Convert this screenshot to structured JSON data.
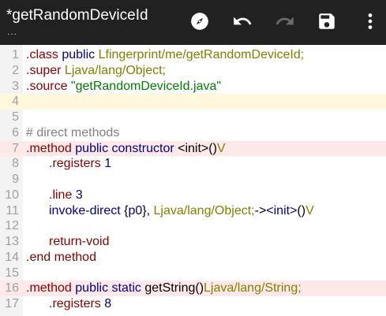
{
  "toolbar": {
    "title": "*getRandomDeviceId",
    "subtitle": "...",
    "icons": [
      "compass-icon",
      "undo-icon",
      "redo-icon",
      "save-icon",
      "more-vert-icon"
    ],
    "redo_enabled": false
  },
  "colors": {
    "toolbar_bg": "#212121",
    "gutter_bg": "#f3f3f3",
    "current_line": "#fff8dc",
    "method_line": "#fde9e9",
    "directive": "#8b0000",
    "modifier": "#00008b",
    "type": "#808000",
    "string": "#008000",
    "comment": "#808080"
  },
  "editor": {
    "lines": [
      {
        "n": "1",
        "tokens": [
          {
            "t": ".class",
            "c": "kw-dir"
          },
          {
            "t": " "
          },
          {
            "t": "public",
            "c": "kw-mod"
          },
          {
            "t": " "
          },
          {
            "t": "Lfingerprint/me/getRandomDeviceId;",
            "c": "type"
          }
        ]
      },
      {
        "n": "2",
        "tokens": [
          {
            "t": ".super",
            "c": "kw-dir"
          },
          {
            "t": " "
          },
          {
            "t": "Ljava/lang/Object;",
            "c": "type"
          }
        ]
      },
      {
        "n": "3",
        "tokens": [
          {
            "t": ".source",
            "c": "kw-dir"
          },
          {
            "t": " "
          },
          {
            "t": "\"getRandomDeviceId.java\"",
            "c": "str"
          }
        ]
      },
      {
        "n": "4",
        "hl": "current",
        "tokens": []
      },
      {
        "n": "5",
        "tokens": []
      },
      {
        "n": "6",
        "tokens": [
          {
            "t": "# direct methods",
            "c": "comment"
          }
        ]
      },
      {
        "n": "7",
        "hl": "method",
        "tokens": [
          {
            "t": ".method",
            "c": "kw-dir"
          },
          {
            "t": " "
          },
          {
            "t": "public",
            "c": "kw-mod"
          },
          {
            "t": " "
          },
          {
            "t": "constructor",
            "c": "kw-mod"
          },
          {
            "t": " "
          },
          {
            "t": "<init>()",
            "c": "plain"
          },
          {
            "t": "V",
            "c": "type"
          }
        ]
      },
      {
        "n": "8",
        "tokens": [
          {
            "indent": true
          },
          {
            "t": ".registers",
            "c": "kw-dir"
          },
          {
            "t": " "
          },
          {
            "t": "1",
            "c": "num"
          }
        ]
      },
      {
        "n": "9",
        "tokens": []
      },
      {
        "n": "10",
        "tokens": [
          {
            "indent": true
          },
          {
            "t": ".line",
            "c": "kw-dir"
          },
          {
            "t": " "
          },
          {
            "t": "3",
            "c": "num"
          }
        ]
      },
      {
        "n": "11",
        "tokens": [
          {
            "indent": true
          },
          {
            "t": "invoke-direct",
            "c": "kw-mod"
          },
          {
            "t": " "
          },
          {
            "t": "{",
            "c": "plain"
          },
          {
            "t": "p0",
            "c": "reg"
          },
          {
            "t": "}, ",
            "c": "plain"
          },
          {
            "t": "Ljava/lang/Object;",
            "c": "type"
          },
          {
            "t": "->",
            "c": "plain"
          },
          {
            "t": "<init>",
            "c": "reg"
          },
          {
            "t": "()",
            "c": "plain"
          },
          {
            "t": "V",
            "c": "type"
          }
        ]
      },
      {
        "n": "12",
        "tokens": []
      },
      {
        "n": "13",
        "tokens": [
          {
            "indent": true
          },
          {
            "t": "return-void",
            "c": "kw-dir"
          }
        ]
      },
      {
        "n": "14",
        "tokens": [
          {
            "t": ".end",
            "c": "kw-dir"
          },
          {
            "t": " "
          },
          {
            "t": "method",
            "c": "kw-dir"
          }
        ]
      },
      {
        "n": "15",
        "tokens": []
      },
      {
        "n": "16",
        "hl": "method",
        "tokens": [
          {
            "t": ".method",
            "c": "kw-dir"
          },
          {
            "t": " "
          },
          {
            "t": "public",
            "c": "kw-mod"
          },
          {
            "t": " "
          },
          {
            "t": "static",
            "c": "kw-mod"
          },
          {
            "t": " "
          },
          {
            "t": "getString()",
            "c": "plain"
          },
          {
            "t": "Ljava/lang/String;",
            "c": "type"
          }
        ]
      },
      {
        "n": "17",
        "tokens": [
          {
            "indent": true
          },
          {
            "t": ".registers",
            "c": "kw-dir"
          },
          {
            "t": " "
          },
          {
            "t": "8",
            "c": "num"
          }
        ]
      }
    ]
  }
}
